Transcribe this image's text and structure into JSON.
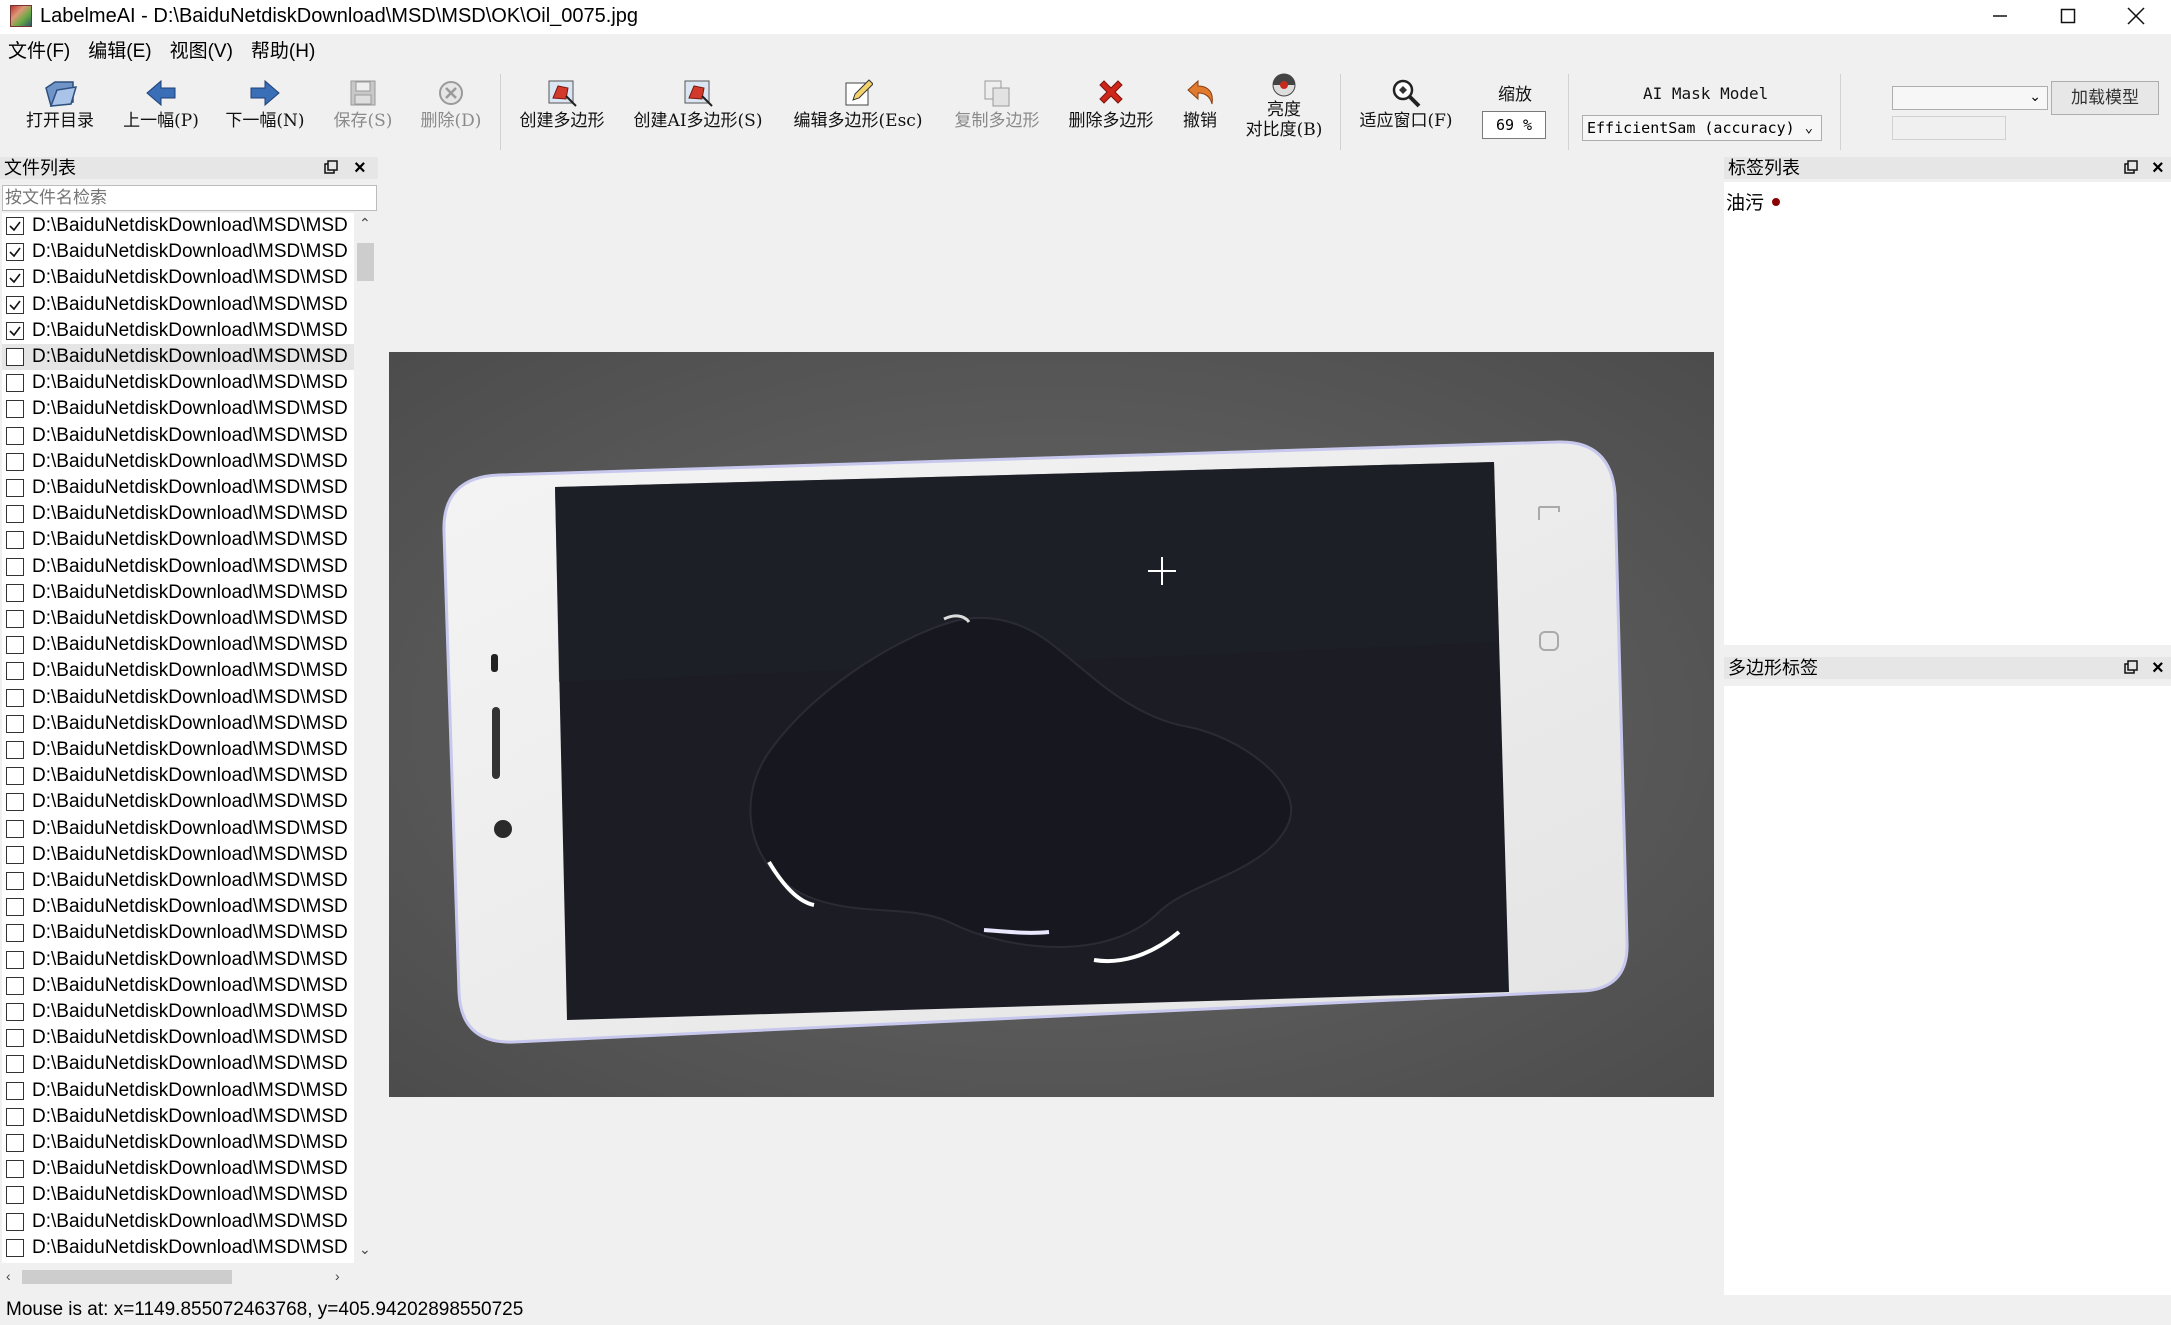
{
  "window": {
    "title": "LabelmeAI - D:\\BaiduNetdiskDownload\\MSD\\MSD\\OK\\Oil_0075.jpg"
  },
  "menu": [
    "文件(F)",
    "编辑(E)",
    "视图(V)",
    "帮助(H)"
  ],
  "toolbar": {
    "open_dir": "打开目录",
    "prev": "上一幅(P)",
    "next": "下一幅(N)",
    "save": "保存(S)",
    "delete": "删除(D)",
    "create_polygon": "创建多边形",
    "create_ai_polygon": "创建AI多边形(S)",
    "edit_polygon": "编辑多边形(Esc)",
    "copy_polygon": "复制多边形",
    "delete_polygon": "删除多边形",
    "undo": "撤销",
    "brightness_line1": "亮度",
    "brightness_line2": "对比度(B)",
    "fit_window": "适应窗口(F)",
    "zoom_label": "缩放",
    "zoom_value": "69 %",
    "ai_model_label": "AI Mask Model",
    "ai_model_value": "EfficientSam (accuracy)",
    "load_model": "加载模型"
  },
  "file_panel": {
    "title": "文件列表",
    "search_placeholder": "按文件名检索",
    "files": [
      {
        "name": "D:\\BaiduNetdiskDownload\\MSD\\MSD",
        "checked": true
      },
      {
        "name": "D:\\BaiduNetdiskDownload\\MSD\\MSD",
        "checked": true
      },
      {
        "name": "D:\\BaiduNetdiskDownload\\MSD\\MSD",
        "checked": true
      },
      {
        "name": "D:\\BaiduNetdiskDownload\\MSD\\MSD",
        "checked": true
      },
      {
        "name": "D:\\BaiduNetdiskDownload\\MSD\\MSD",
        "checked": true
      },
      {
        "name": "D:\\BaiduNetdiskDownload\\MSD\\MSD",
        "checked": false,
        "selected": true
      },
      {
        "name": "D:\\BaiduNetdiskDownload\\MSD\\MSD",
        "checked": false
      },
      {
        "name": "D:\\BaiduNetdiskDownload\\MSD\\MSD",
        "checked": false
      },
      {
        "name": "D:\\BaiduNetdiskDownload\\MSD\\MSD",
        "checked": false
      },
      {
        "name": "D:\\BaiduNetdiskDownload\\MSD\\MSD",
        "checked": false
      },
      {
        "name": "D:\\BaiduNetdiskDownload\\MSD\\MSD",
        "checked": false
      },
      {
        "name": "D:\\BaiduNetdiskDownload\\MSD\\MSD",
        "checked": false
      },
      {
        "name": "D:\\BaiduNetdiskDownload\\MSD\\MSD",
        "checked": false
      },
      {
        "name": "D:\\BaiduNetdiskDownload\\MSD\\MSD",
        "checked": false
      },
      {
        "name": "D:\\BaiduNetdiskDownload\\MSD\\MSD",
        "checked": false
      },
      {
        "name": "D:\\BaiduNetdiskDownload\\MSD\\MSD",
        "checked": false
      },
      {
        "name": "D:\\BaiduNetdiskDownload\\MSD\\MSD",
        "checked": false
      },
      {
        "name": "D:\\BaiduNetdiskDownload\\MSD\\MSD",
        "checked": false
      },
      {
        "name": "D:\\BaiduNetdiskDownload\\MSD\\MSD",
        "checked": false
      },
      {
        "name": "D:\\BaiduNetdiskDownload\\MSD\\MSD",
        "checked": false
      },
      {
        "name": "D:\\BaiduNetdiskDownload\\MSD\\MSD",
        "checked": false
      },
      {
        "name": "D:\\BaiduNetdiskDownload\\MSD\\MSD",
        "checked": false
      },
      {
        "name": "D:\\BaiduNetdiskDownload\\MSD\\MSD",
        "checked": false
      },
      {
        "name": "D:\\BaiduNetdiskDownload\\MSD\\MSD",
        "checked": false
      },
      {
        "name": "D:\\BaiduNetdiskDownload\\MSD\\MSD",
        "checked": false
      },
      {
        "name": "D:\\BaiduNetdiskDownload\\MSD\\MSD",
        "checked": false
      },
      {
        "name": "D:\\BaiduNetdiskDownload\\MSD\\MSD",
        "checked": false
      },
      {
        "name": "D:\\BaiduNetdiskDownload\\MSD\\MSD",
        "checked": false
      },
      {
        "name": "D:\\BaiduNetdiskDownload\\MSD\\MSD",
        "checked": false
      },
      {
        "name": "D:\\BaiduNetdiskDownload\\MSD\\MSD",
        "checked": false
      },
      {
        "name": "D:\\BaiduNetdiskDownload\\MSD\\MSD",
        "checked": false
      },
      {
        "name": "D:\\BaiduNetdiskDownload\\MSD\\MSD",
        "checked": false
      },
      {
        "name": "D:\\BaiduNetdiskDownload\\MSD\\MSD",
        "checked": false
      },
      {
        "name": "D:\\BaiduNetdiskDownload\\MSD\\MSD",
        "checked": false
      },
      {
        "name": "D:\\BaiduNetdiskDownload\\MSD\\MSD",
        "checked": false
      },
      {
        "name": "D:\\BaiduNetdiskDownload\\MSD\\MSD",
        "checked": false
      },
      {
        "name": "D:\\BaiduNetdiskDownload\\MSD\\MSD",
        "checked": false
      },
      {
        "name": "D:\\BaiduNetdiskDownload\\MSD\\MSD",
        "checked": false
      },
      {
        "name": "D:\\BaiduNetdiskDownload\\MSD\\MSD",
        "checked": false
      },
      {
        "name": "D:\\BaiduNetdiskDownload\\MSD\\MSD",
        "checked": false
      },
      {
        "name": "D:\\BaiduNetdiskDownload\\MSD\\MSD",
        "checked": false
      }
    ]
  },
  "label_panel": {
    "title": "标签列表",
    "labels": [
      {
        "name": "油污",
        "color": "#8b0000"
      }
    ]
  },
  "polygon_panel": {
    "title": "多边形标签"
  },
  "status": {
    "text": "Mouse is at: x=1149.855072463768, y=405.94202898550725"
  },
  "colors": {
    "accent_blue": "#3a6fb7",
    "delete_red": "#d0261a"
  }
}
